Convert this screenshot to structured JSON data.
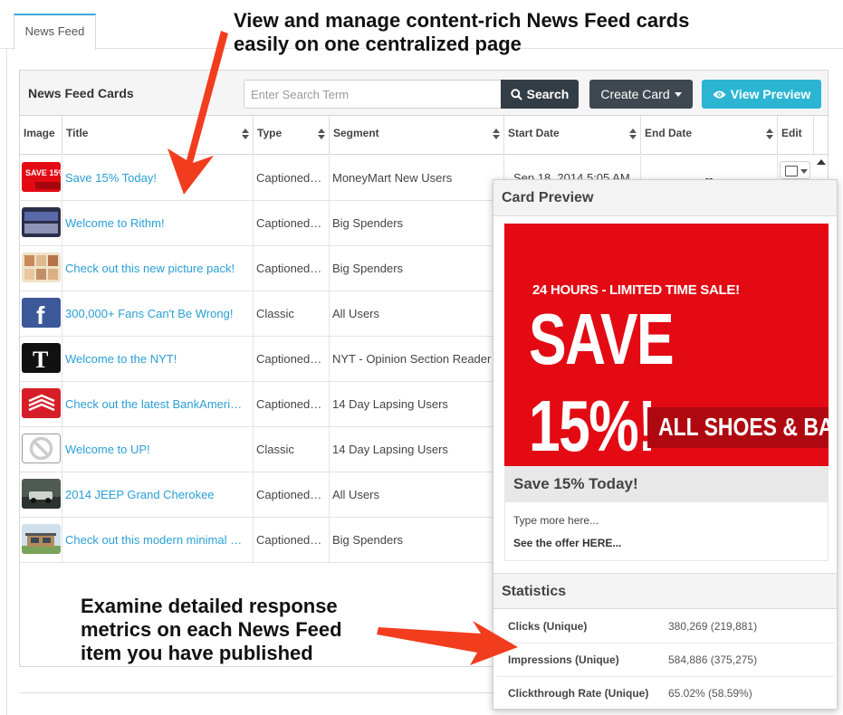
{
  "tabs": [
    {
      "label": "News Feed"
    }
  ],
  "panel": {
    "title": "News Feed Cards",
    "search_placeholder": "Enter Search Term",
    "search_button": "Search",
    "create_button": "Create Card",
    "preview_button": "View Preview"
  },
  "table": {
    "headers": [
      "Image",
      "Title",
      "Type",
      "Segment",
      "Start Date",
      "End Date",
      "Edit"
    ],
    "rows": [
      {
        "title": "Save 15% Today!",
        "type": "Captioned…",
        "segment": "MoneyMart New Users",
        "start": "Sep 18, 2014 5:05 AM",
        "end": "--",
        "thumb": "save-15"
      },
      {
        "title": "Welcome to Rithm!",
        "type": "Captioned…",
        "segment": "Big Spenders",
        "thumb": "rithm"
      },
      {
        "title": "Check out this new picture pack!",
        "type": "Captioned…",
        "segment": "Big Spenders",
        "thumb": "picture-pack"
      },
      {
        "title": "300,000+ Fans Can't Be Wrong!",
        "type": "Classic",
        "segment": "All Users",
        "thumb": "facebook"
      },
      {
        "title": "Welcome to the NYT!",
        "type": "Captioned…",
        "segment": "NYT - Opinion Section Reader",
        "thumb": "nyt"
      },
      {
        "title": "Check out the latest BankAmeri…",
        "type": "Captioned…",
        "segment": "14 Day Lapsing Users",
        "thumb": "bank"
      },
      {
        "title": "Welcome to UP!",
        "type": "Classic",
        "segment": "14 Day Lapsing Users",
        "thumb": "no-image"
      },
      {
        "title": "2014 JEEP Grand Cherokee",
        "type": "Captioned…",
        "segment": "All Users",
        "thumb": "jeep"
      },
      {
        "title": "Check out this modern minimal …",
        "type": "Captioned…",
        "segment": "Big Spenders",
        "thumb": "house"
      }
    ]
  },
  "preview": {
    "header": "Card Preview",
    "image_line1": "24 HOURS - LIMITED TIME SALE!",
    "image_big": "SAVE 15%!",
    "image_band": "ALL SHOES & BAGS",
    "card_title": "Save 15% Today!",
    "card_body": "Type more here...",
    "card_link": "See the offer HERE...",
    "stats_header": "Statistics",
    "stats": [
      {
        "label": "Clicks (Unique)",
        "value": "380,269 (219,881)"
      },
      {
        "label": "Impressions (Unique)",
        "value": "584,886 (375,275)"
      },
      {
        "label": "Clickthrough Rate (Unique)",
        "value": "65.02% (58.59%)"
      }
    ]
  },
  "annotations": {
    "top_line1": "View and manage content-rich News Feed cards",
    "top_line2": "easily on one centralized page",
    "bottom_line1": "Examine detailed response",
    "bottom_line2": "metrics on each News Feed",
    "bottom_line3": "item you have published"
  },
  "colors": {
    "accent": "#2bb5d3",
    "link": "#2a9fd6",
    "dark_button": "#3f4850",
    "annotation_arrow": "#f23c1e",
    "sale_red": "#e30a14"
  }
}
